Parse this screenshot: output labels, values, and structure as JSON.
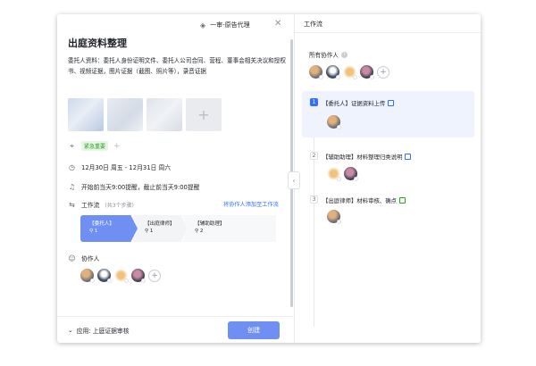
{
  "header": {
    "mode_label": "一审-原告代理",
    "title": "出庭资料整理"
  },
  "description": "委托人资料：委托人身份证明文件、委托人公司合同、营程、董事会相关决议和授权书、视频证据，图片证据（截图、照片等），录音证据",
  "attachments": {
    "add_symbol": "+"
  },
  "tag": {
    "label": "紧急重要",
    "add_symbol": "+"
  },
  "date_range": "12月30日 周五 - 12月31日 周六",
  "reminder": "开始前当天9:00提醒，截止前当天9:00提醒",
  "workflow": {
    "label": "工作流",
    "count_note": "(共3个步骤)",
    "add_link": "将协作人添加至工作流",
    "steps": [
      {
        "label": "【委托人】",
        "count": "1"
      },
      {
        "label": "【出庭律师】",
        "count": "1"
      },
      {
        "label": "【辅助助理】",
        "count": "2"
      }
    ]
  },
  "collaborators": {
    "label": "协作人",
    "add_symbol": "+"
  },
  "footer": {
    "app_label": "应用: 上庭证据审核",
    "create_button": "创建"
  },
  "right_panel": {
    "title": "工作流",
    "all_collaborators": "所有协作人",
    "steps": [
      {
        "num": "1",
        "title": "【委托人】证据资料上传"
      },
      {
        "num": "2",
        "title": "【辅助助理】材料整理归类说明"
      },
      {
        "num": "3",
        "title": "【出庭律师】材料审核、确点"
      }
    ]
  },
  "colors": {
    "primary": "#3370ff",
    "primary_light": "#6f8ff2",
    "tag_green": "#2ea121"
  }
}
